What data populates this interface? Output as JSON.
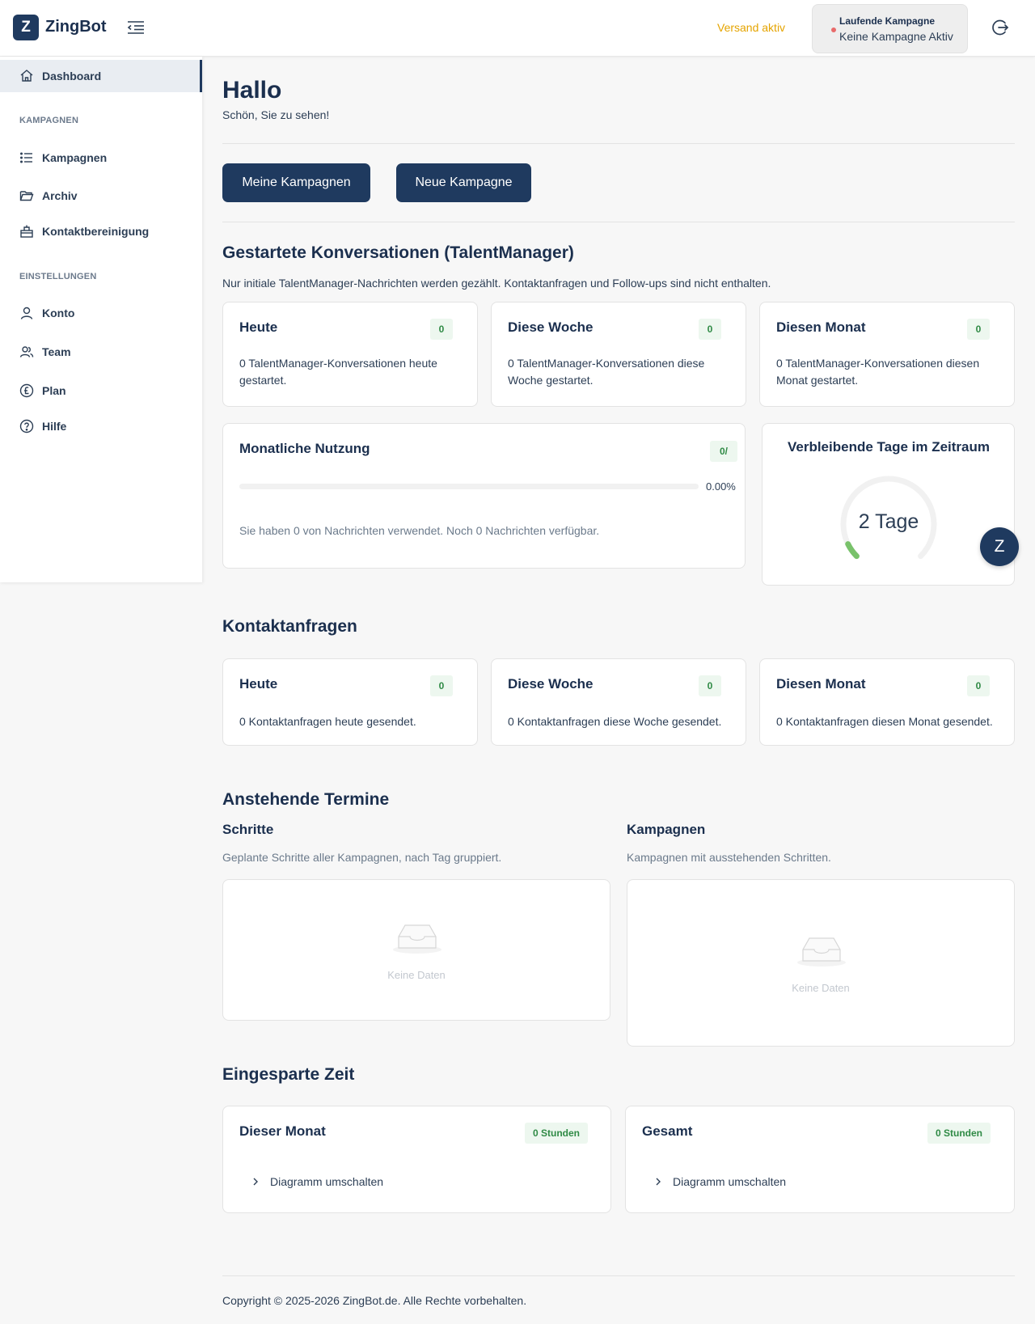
{
  "header": {
    "logo_letter": "Z",
    "app_name": "ZingBot",
    "versand": "Versand aktiv",
    "campaign_title": "Laufende Kampagne",
    "campaign_status": "Keine Kampagne Aktiv",
    "icons": [
      "collapse-menu-icon",
      "logout-icon"
    ]
  },
  "sidebar": {
    "items": [
      {
        "label": "Dashboard",
        "icon": "home-icon"
      },
      {
        "label": "Kampagnen",
        "icon": "list-icon"
      },
      {
        "label": "Archiv",
        "icon": "folder-icon"
      },
      {
        "label": "Kontaktbereinigung",
        "icon": "cleanup-icon"
      },
      {
        "label": "Konto",
        "icon": "user-icon"
      },
      {
        "label": "Team",
        "icon": "team-icon"
      },
      {
        "label": "Plan",
        "icon": "pound-icon"
      },
      {
        "label": "Hilfe",
        "icon": "help-icon"
      }
    ],
    "sections": [
      "KAMPAGNEN",
      "EINSTELLUNGEN"
    ]
  },
  "main": {
    "hello": "Hallo",
    "greeting": "Schön, Sie zu sehen!",
    "btn_my": "Meine Kampagnen",
    "btn_new": "Neue Kampagne",
    "conv": {
      "title": "Gestartete Konversationen (TalentManager)",
      "note": "Nur initiale TalentManager-Nachrichten werden gezählt. Kontaktanfragen und Follow-ups sind nicht enthalten.",
      "cards": [
        {
          "title": "Heute",
          "count": "0",
          "text1": "0 TalentManager-Konversationen heute",
          "text2": "gestartet."
        },
        {
          "title": "Diese Woche",
          "count": "0",
          "text1": "0 TalentManager-Konversationen diese",
          "text2": "Woche gestartet."
        },
        {
          "title": "Diesen Monat",
          "count": "0",
          "text1": "0 TalentManager-Konversationen diesen",
          "text2": "Monat gestartet."
        }
      ]
    },
    "usage": {
      "title": "Monatliche Nutzung",
      "badge": "0/",
      "progress": 0,
      "percent_label": "0.00%",
      "text": "Sie haben 0 von Nachrichten verwendet. Noch 0 Nachrichten verfügbar."
    },
    "remaining": {
      "title": "Verbleibende Tage im Zeitraum",
      "label": "2 Tage",
      "fraction": 0.07
    },
    "fab_letter": "Z",
    "contact": {
      "title": "Kontaktanfragen",
      "cards": [
        {
          "title": "Heute",
          "count": "0",
          "text": "0 Kontaktanfragen heute gesendet."
        },
        {
          "title": "Diese Woche",
          "count": "0",
          "text": "0 Kontaktanfragen diese Woche gesendet."
        },
        {
          "title": "Diesen Monat",
          "count": "0",
          "text": "0 Kontaktanfragen diesen Monat gesendet."
        }
      ]
    },
    "appointments": {
      "title": "Anstehende Termine",
      "steps_title": "Schritte",
      "steps_note": "Geplante Schritte aller Kampagnen, nach Tag gruppiert.",
      "campaigns_title": "Kampagnen",
      "campaigns_note": "Kampagnen mit ausstehenden Schritten.",
      "empty": "Keine Daten"
    },
    "saved": {
      "title": "Eingesparte Zeit",
      "cards": [
        {
          "title": "Dieser Monat",
          "badge": "0 Stunden",
          "toggle": "Diagramm umschalten"
        },
        {
          "title": "Gesamt",
          "badge": "0 Stunden",
          "toggle": "Diagramm umschalten"
        }
      ]
    },
    "footer": "Copyright © 2025-2026 ZingBot.de. Alle Rechte vorbehalten."
  }
}
